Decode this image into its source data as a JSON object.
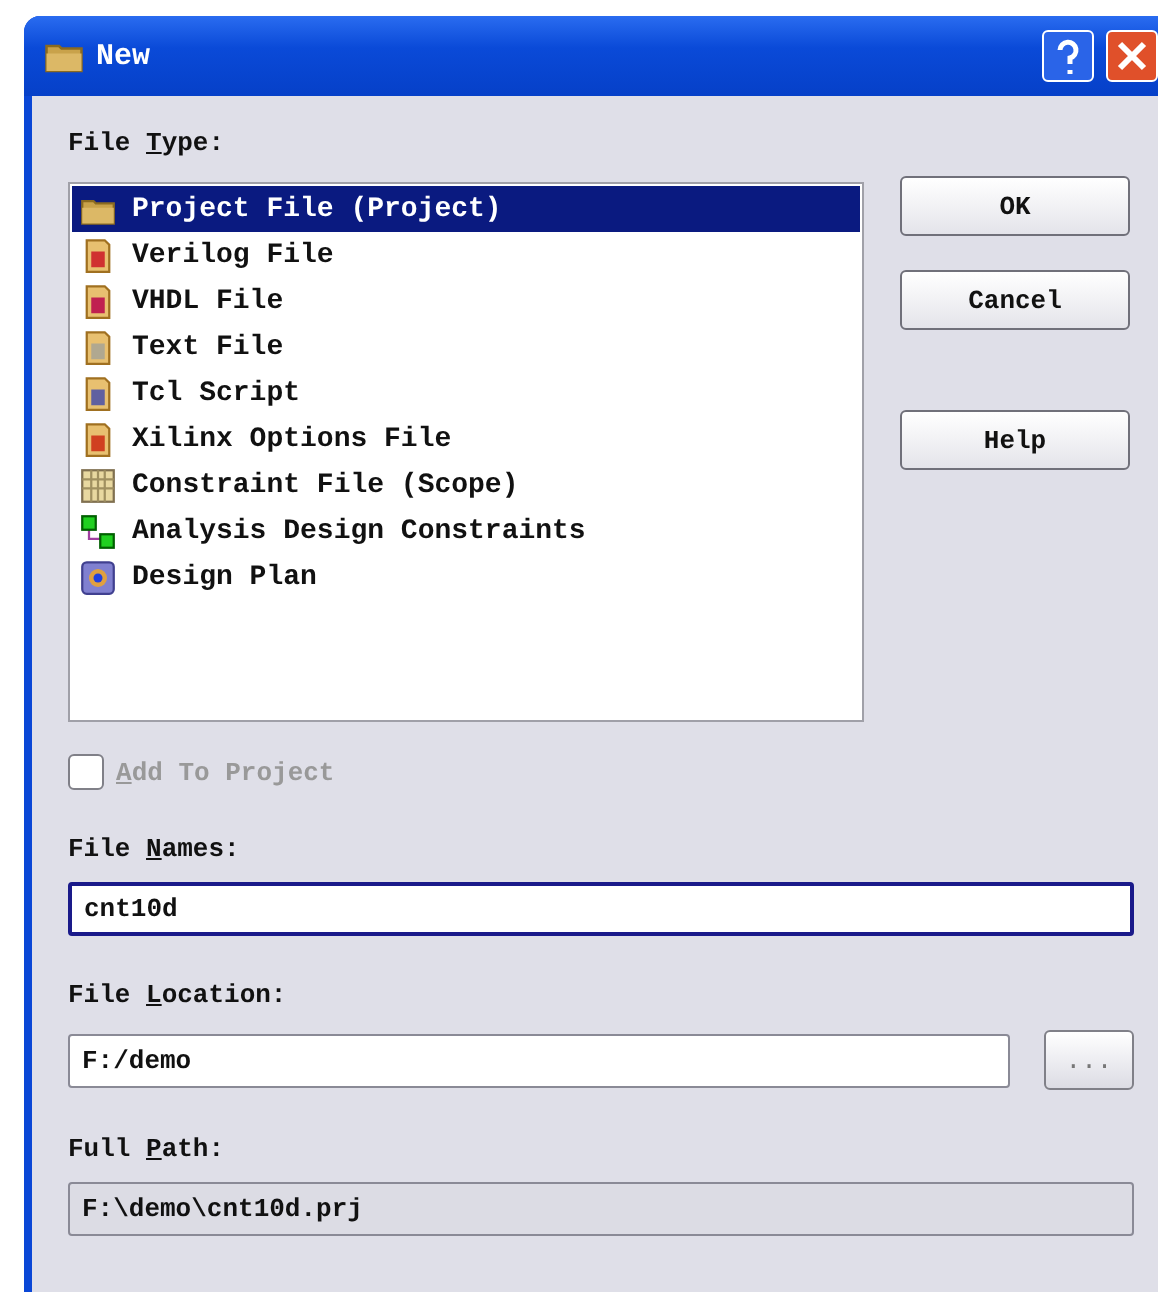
{
  "window": {
    "title": "New"
  },
  "file_type": {
    "label": {
      "before": "File ",
      "key": "T",
      "after": "ype:"
    },
    "items": [
      {
        "label": "Project File (Project)",
        "kind": "project",
        "selected": true
      },
      {
        "label": "Verilog File",
        "kind": "verilog",
        "selected": false
      },
      {
        "label": "VHDL File",
        "kind": "vhdl",
        "selected": false
      },
      {
        "label": "Text File",
        "kind": "text",
        "selected": false
      },
      {
        "label": "Tcl Script",
        "kind": "tcl",
        "selected": false
      },
      {
        "label": "Xilinx Options File",
        "kind": "xilinx",
        "selected": false
      },
      {
        "label": "Constraint File (Scope)",
        "kind": "constraint",
        "selected": false
      },
      {
        "label": "Analysis Design Constraints",
        "kind": "adc",
        "selected": false
      },
      {
        "label": "Design Plan",
        "kind": "plan",
        "selected": false
      }
    ]
  },
  "buttons": [
    {
      "label": "OK",
      "kind": "ok"
    },
    {
      "label": "Cancel",
      "kind": "cancel"
    },
    {
      "label": "Help",
      "kind": "help"
    }
  ],
  "add_to_project": {
    "label": {
      "key": "A",
      "after": "dd To Project"
    },
    "checked": false,
    "disabled": true
  },
  "file_names": {
    "label": {
      "before": "File ",
      "key": "N",
      "after": "ames:"
    },
    "value": "cnt10d",
    "focused": true
  },
  "file_location": {
    "label": {
      "before": "File ",
      "key": "L",
      "after": "ocation:"
    },
    "value": "F:/demo",
    "browse": "..."
  },
  "full_path": {
    "label": {
      "before": "Full ",
      "key": "P",
      "after": "ath:"
    },
    "value": "F:\\demo\\cnt10d.prj",
    "disabled": true
  }
}
